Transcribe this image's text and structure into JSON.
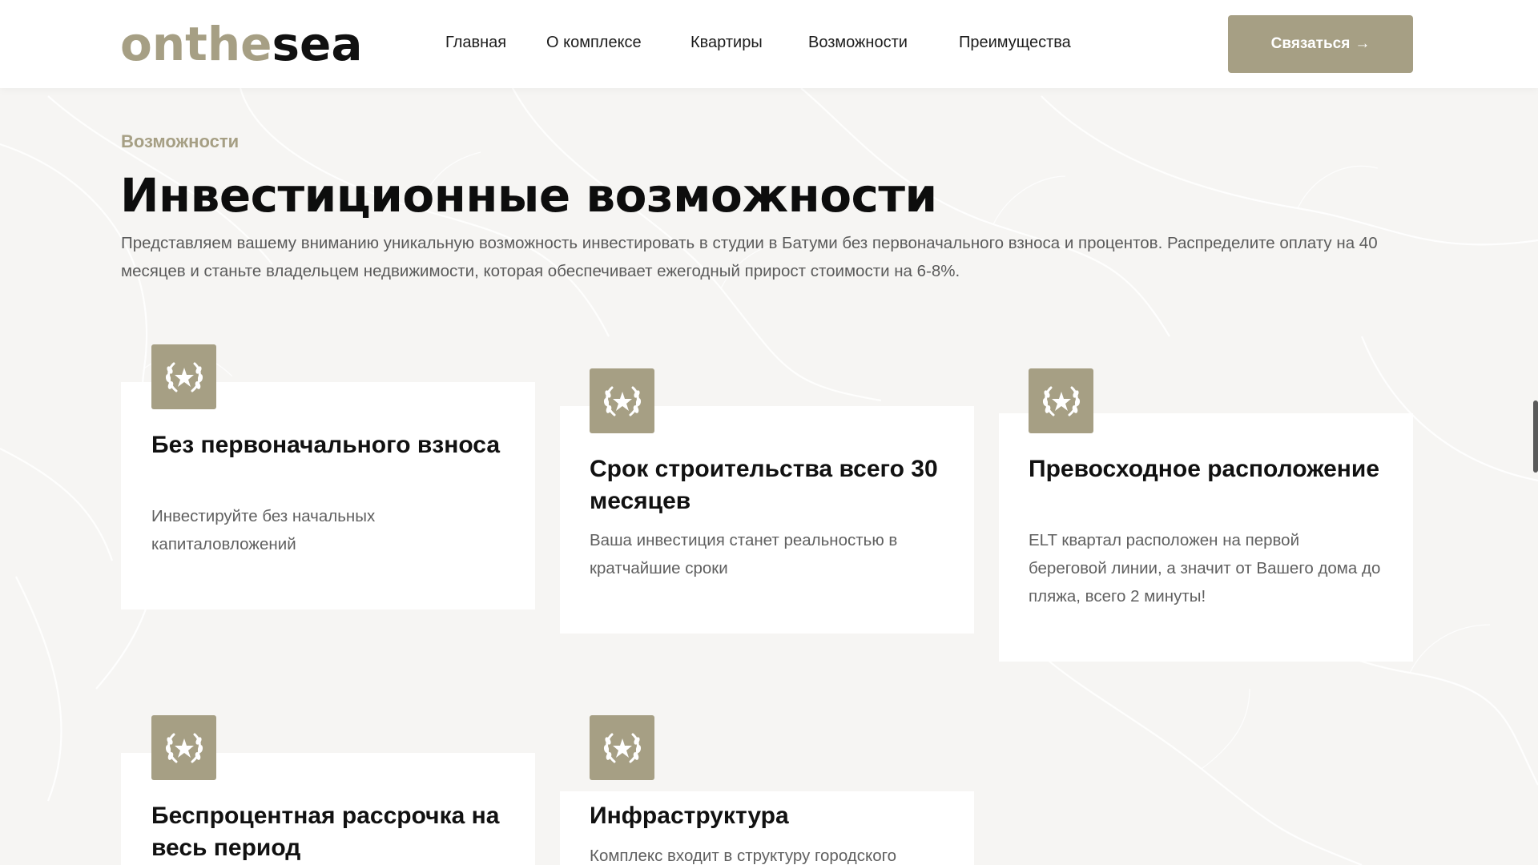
{
  "header": {
    "logo_part1": "onthe",
    "logo_part2": "sea",
    "nav": [
      "Главная",
      "О комплексе",
      "Квартиры",
      "Возможности",
      "Преимущества"
    ],
    "contact_label": "Связаться",
    "contact_arrow": "→"
  },
  "section": {
    "eyebrow": "Возможности",
    "title": "Инвестиционные возможности",
    "intro": "Представляем вашему вниманию уникальную возможность инвестировать в студии в Батуми без первоначального взноса и процентов. Распределите оплату на 40 месяцев и станьте владельцем недвижимости, которая обеспечивает ежегодный прирост стоимости на 6-8%."
  },
  "cards": [
    {
      "title": "Без первоначального взноса",
      "text": "Инвестируйте без начальных капиталовложений",
      "icon": "laurel-star-icon"
    },
    {
      "title": "Срок строительства всего 30 месяцев",
      "text": "Ваша инвестиция станет реальностью в кратчайшие сроки",
      "icon": "laurel-star-icon"
    },
    {
      "title": "Превосходное расположение",
      "text": "ELT квартал расположен на первой береговой линии, а значит от Вашего дома до пляжа, всего 2 минуты!",
      "icon": "laurel-star-icon"
    },
    {
      "title": "Беспроцентная рассрочка на весь период",
      "text": "",
      "icon": "laurel-star-icon"
    },
    {
      "title": "Инфраструктура",
      "text": "Комплекс входит в структуру городского",
      "icon": "laurel-star-icon"
    }
  ],
  "colors": {
    "accent": "#a69f84",
    "background": "#f6f5f3",
    "card": "#ffffff",
    "text_dark": "#111111",
    "text_muted": "#606060"
  }
}
